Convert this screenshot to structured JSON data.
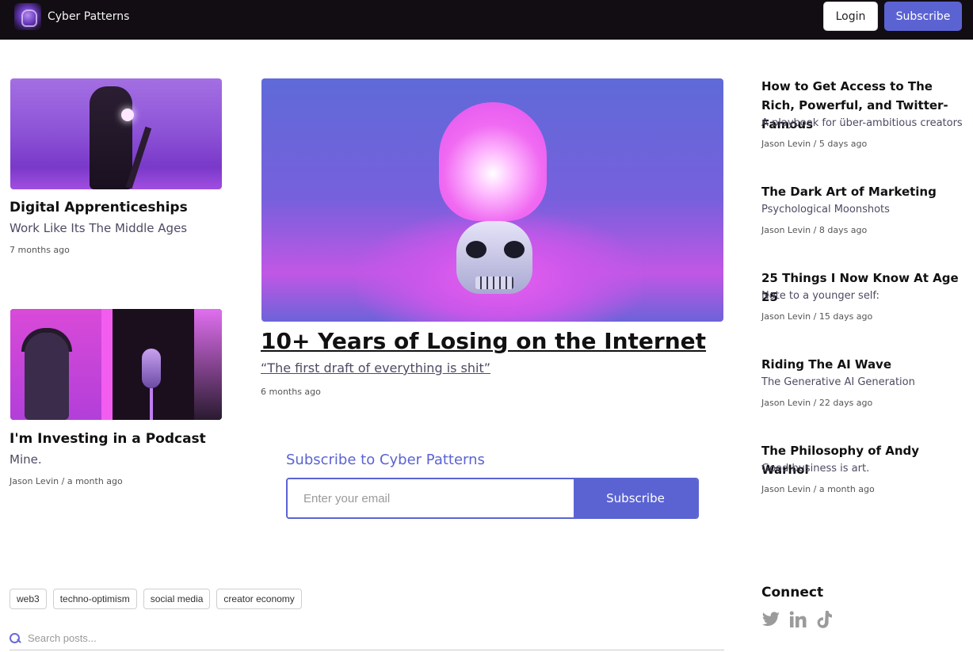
{
  "header": {
    "brand_name": "Cyber Patterns",
    "login_label": "Login",
    "subscribe_label": "Subscribe"
  },
  "left_posts": [
    {
      "title": "Digital Apprenticeships",
      "subtitle": "Work Like Its The Middle Ages",
      "meta": "7 months ago"
    },
    {
      "title": "I'm Investing in a Podcast",
      "subtitle": "Mine.",
      "meta": "Jason Levin / a month ago"
    }
  ],
  "featured": {
    "title": "10+ Years of Losing on the Internet",
    "subtitle": "“The first draft of everything is shit”",
    "meta": "6 months ago"
  },
  "subscribe_box": {
    "heading": "Subscribe to Cyber Patterns",
    "placeholder": "Enter your email",
    "button_label": "Subscribe"
  },
  "side_posts": [
    {
      "title": "How to Get Access to The Rich, Powerful, and Twitter-Famous",
      "subtitle": "A playbook for über-ambitious creators",
      "meta": "Jason Levin / 5 days ago"
    },
    {
      "title": "The Dark Art of Marketing",
      "subtitle": "Psychological Moonshots",
      "meta": "Jason Levin / 8 days ago"
    },
    {
      "title": "25 Things I Now Know At Age 25",
      "subtitle": "Note to a younger self:",
      "meta": "Jason Levin / 15 days ago"
    },
    {
      "title": "Riding The AI Wave",
      "subtitle": "The Generative AI Generation",
      "meta": "Jason Levin / 22 days ago"
    },
    {
      "title": "The Philosophy of Andy Warhol",
      "subtitle": "Good business is art.",
      "meta": "Jason Levin / a month ago"
    }
  ],
  "tags": [
    "web3",
    "techno-optimism",
    "social media",
    "creator economy"
  ],
  "search": {
    "placeholder": "Search posts..."
  },
  "connect": {
    "heading": "Connect",
    "icons": [
      "twitter-icon",
      "linkedin-icon",
      "tiktok-icon"
    ]
  },
  "colors": {
    "accent": "#5b63d3",
    "topbar": "#120d12"
  }
}
